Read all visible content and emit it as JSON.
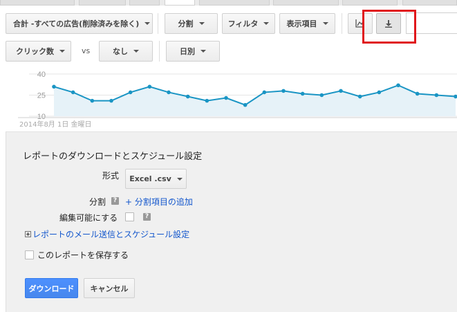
{
  "toolbar": {
    "campaign_filter": "合計 -すべての広告(削除済みを除く)",
    "segment": "分割",
    "filter": "フィルタ",
    "columns": "表示項目"
  },
  "metrics": {
    "primary_metric": "クリック数",
    "vs_label": "vs",
    "secondary_metric": "なし",
    "period": "日別",
    "primary_color": "#1a95c4"
  },
  "icons": {
    "chart_toggle": "chart-line-icon",
    "download": "download-icon"
  },
  "chart_data": {
    "type": "area",
    "y_ticks": [
      "40",
      "25",
      "10"
    ],
    "ylim": [
      10,
      40
    ],
    "start_label": "2014年8月 1日 金曜日",
    "values": [
      31,
      27,
      21,
      21,
      27,
      31,
      27,
      24,
      21,
      23,
      18,
      27,
      28,
      26,
      25,
      28,
      24,
      27,
      32,
      26,
      25,
      24
    ],
    "line_color": "#1a95c4",
    "fill_color": "#e6f2f8"
  },
  "download_panel": {
    "title": "レポートのダウンロードとスケジュール設定",
    "format_label": "形式",
    "format_value": "Excel .csv",
    "segment_label": "分割",
    "help_glyph": "?",
    "add_segment_link": "+ 分割項目の追加",
    "editable_label": "編集可能にする",
    "email_schedule_link": "レポートのメール送信とスケジュール設定",
    "save_report_label": "このレポートを保存する",
    "download_button": "ダウンロード",
    "cancel_button": "キャンセル"
  }
}
